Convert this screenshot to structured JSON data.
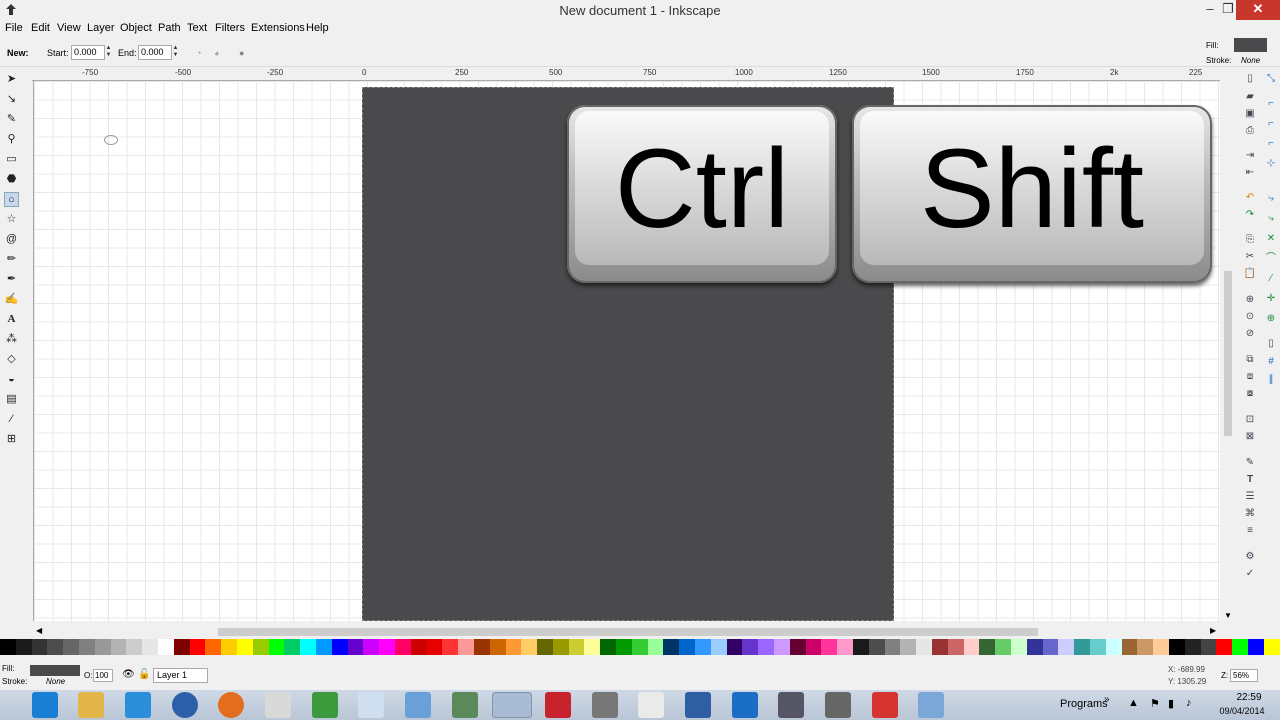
{
  "window": {
    "title": "New document 1 - Inkscape",
    "controls": [
      "–",
      "❐",
      "✕"
    ]
  },
  "menu": [
    "File",
    "Edit",
    "View",
    "Layer",
    "Object",
    "Path",
    "Text",
    "Filters",
    "Extensions",
    "Help"
  ],
  "tool_controls": {
    "new_label": "New:",
    "start_label": "Start:",
    "start_value": "0.000",
    "end_label": "End:",
    "end_value": "0.000"
  },
  "style_indicator": {
    "fill_label": "Fill:",
    "stroke_label": "Stroke:",
    "stroke_value": "None",
    "fill_color": "#4a4a4d"
  },
  "ruler": {
    "ticks": [
      "-750",
      "-500",
      "-250",
      "0",
      "250",
      "500",
      "750",
      "1000",
      "1250",
      "1500",
      "1750",
      "2k",
      "225"
    ]
  },
  "canvas": {
    "keys": [
      {
        "label": "Ctrl"
      },
      {
        "label": "Shift"
      }
    ]
  },
  "status": {
    "fill_label": "Fill:",
    "stroke_label": "Stroke:",
    "stroke_value": "None",
    "opacity_label": "O:",
    "opacity_value": "100",
    "layer": "Layer 1",
    "x_readout": "X: -689.99",
    "y_readout": "Y: 1305.29",
    "zoom_label": "Z:",
    "zoom_value": "56%"
  },
  "taskbar": {
    "programs_label": "Programs",
    "time": "22:59",
    "date": "09/04/2014"
  },
  "colors": {
    "page": "#4a4a4d",
    "close_button": "#c7372c"
  }
}
